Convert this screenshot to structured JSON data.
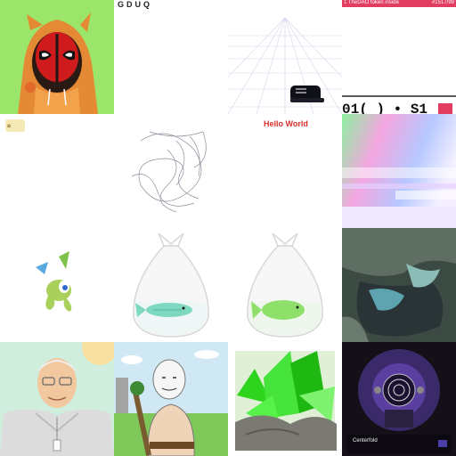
{
  "tiles": {
    "r0c1": {
      "text": "GDUQ"
    },
    "r0c3": {
      "banner_left": "1 TheDAO token inside",
      "banner_right": "#1517/99",
      "code": "01( ) • S1"
    },
    "r1c2": {
      "text": "Hello World"
    },
    "r3c3": {
      "title": "Centerfold"
    }
  },
  "colors": {
    "lime": "#9be56a",
    "hello_red": "#d9302c",
    "dao_pink": "#e23d60"
  }
}
